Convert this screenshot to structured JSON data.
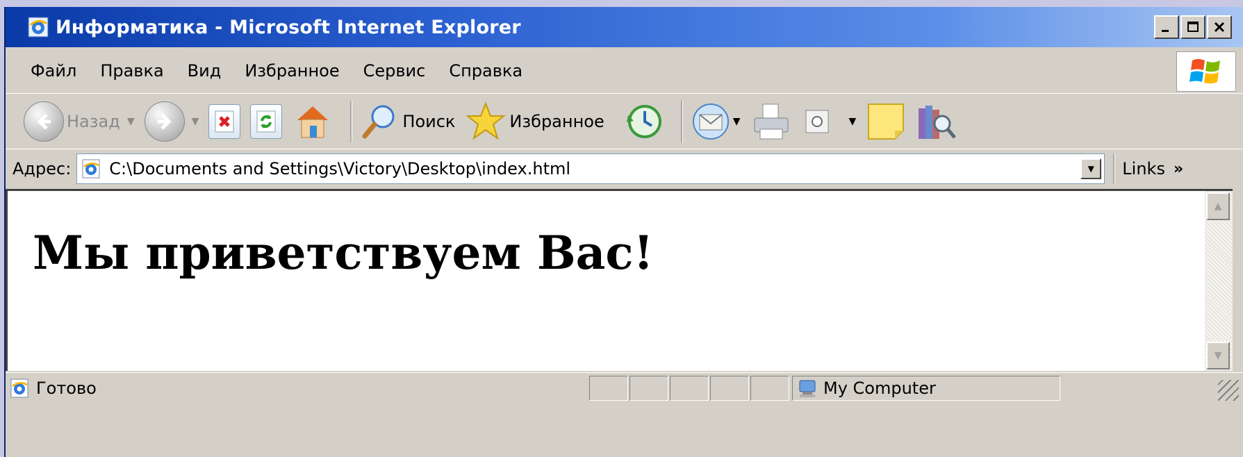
{
  "window": {
    "title": "Информатика - Microsoft Internet Explorer",
    "buttons": {
      "minimize": "_",
      "maximize": "□",
      "close": "×"
    }
  },
  "menubar": {
    "items": [
      "Файл",
      "Правка",
      "Вид",
      "Избранное",
      "Сервис",
      "Справка"
    ]
  },
  "toolbar": {
    "back_label": "Назад",
    "search_label": "Поиск",
    "favorites_label": "Избранное"
  },
  "address": {
    "label": "Адрес:",
    "value": "C:\\Documents and Settings\\Victory\\Desktop\\index.html",
    "links_label": "Links",
    "links_chevron": "»"
  },
  "content": {
    "heading": "Мы приветствуем Вас!"
  },
  "statusbar": {
    "status_text": "Готово",
    "zone_text": "My Computer"
  },
  "colors": {
    "titlebar_start": "#0a3aa8",
    "titlebar_end": "#a9c6f2",
    "chrome": "#d4d0c8",
    "desktop": "#c9c8e4"
  },
  "icons": [
    "ie-logo-icon",
    "windows-logo-icon",
    "back-arrow-icon",
    "forward-arrow-icon",
    "stop-icon",
    "refresh-icon",
    "home-icon",
    "search-icon",
    "favorites-star-icon",
    "history-icon",
    "mail-icon",
    "print-icon",
    "edit-icon",
    "notes-icon",
    "research-icon",
    "page-icon",
    "computer-icon"
  ]
}
